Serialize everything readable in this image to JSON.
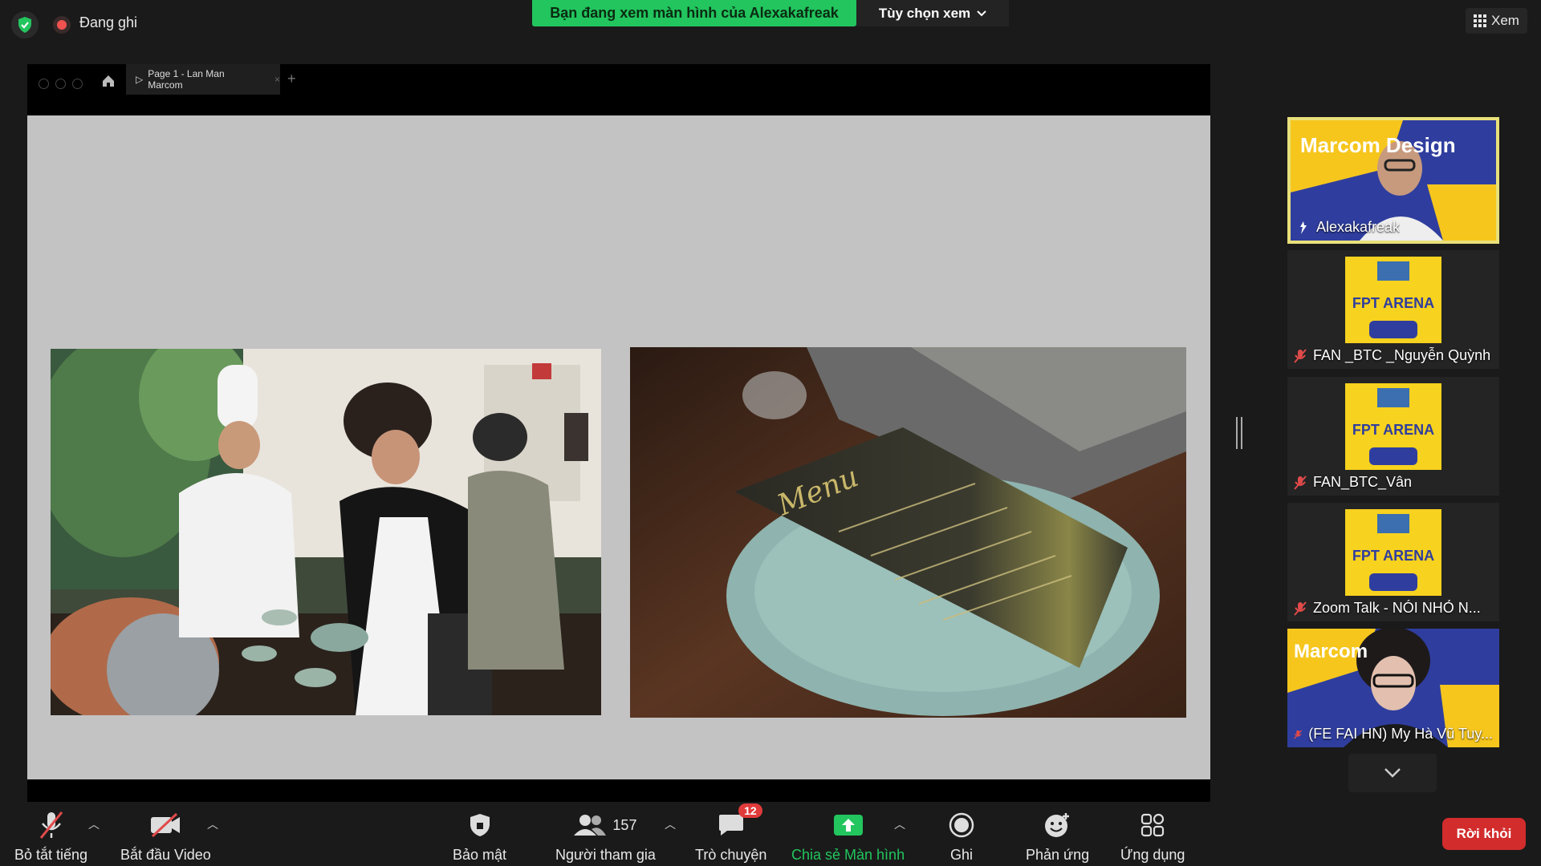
{
  "top": {
    "recording_label": "Đang ghi",
    "banner_text": "Bạn đang xem màn hình của Alexakafreak",
    "view_options_label": "Tùy chọn xem",
    "view_button_label": "Xem"
  },
  "shared_screen": {
    "tab_title": "Page 1 - Lan Man Marcom"
  },
  "participants": [
    {
      "name": "Alexakafreak",
      "poster_text": "Marcom Design",
      "active": true,
      "mic": "active-speaker"
    },
    {
      "name": "FAN _BTC _Nguyễn Quỳnh",
      "poster_text": "FPT ARENA",
      "active": false,
      "mic": "muted"
    },
    {
      "name": "FAN_BTC_Vân",
      "poster_text": "FPT ARENA",
      "active": false,
      "mic": "muted"
    },
    {
      "name": "Zoom Talk - NÓI NHỎ N...",
      "poster_text": "FPT ARENA",
      "active": false,
      "mic": "muted"
    },
    {
      "name": "(FE FAI HN) My Hà Vũ Tuy...",
      "poster_text": "Marcom",
      "active": false,
      "mic": "muted"
    }
  ],
  "toolbar": {
    "mute_all_label": "Bỏ tắt tiếng",
    "start_video_label": "Bắt đầu Video",
    "security_label": "Bảo mật",
    "participants_label": "Người tham gia",
    "participants_count": "157",
    "chat_label": "Trò chuyện",
    "chat_badge": "12",
    "share_label": "Chia sẻ Màn hình",
    "record_label": "Ghi",
    "reactions_label": "Phản ứng",
    "apps_label": "Ứng dụng",
    "leave_label": "Rời khỏi"
  },
  "colors": {
    "share_green": "#22c55e",
    "leave_red": "#d22c2c",
    "active_border": "#e8e07a",
    "muted_red": "#e04a4a"
  }
}
